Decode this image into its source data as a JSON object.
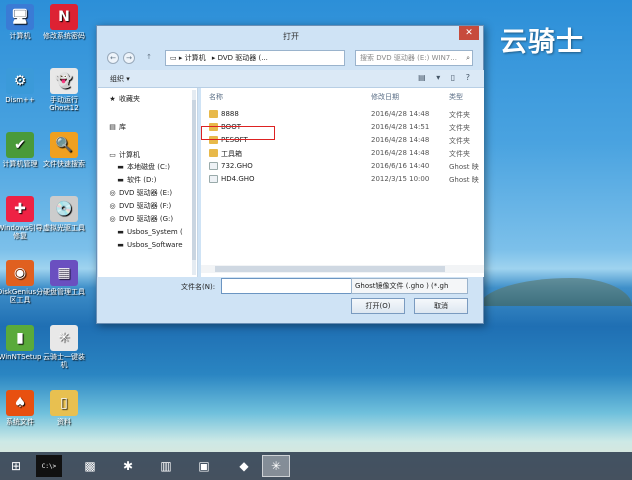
{
  "brand": "云骑士",
  "desktop_icons": [
    {
      "label": "计算机",
      "glyph": "🖥"
    },
    {
      "label": "修改系统密码",
      "glyph": "N"
    },
    {
      "label": "Dism++",
      "glyph": "⚙"
    },
    {
      "label": "手动运行 Ghost12",
      "glyph": "👻"
    },
    {
      "label": "计算机管理",
      "glyph": "✔"
    },
    {
      "label": "文件快速搜索",
      "glyph": "🔍"
    },
    {
      "label": "Windows引导修复",
      "glyph": "✚"
    },
    {
      "label": "虚拟光驱工具",
      "glyph": "💿"
    },
    {
      "label": "DiskGenius分区工具",
      "glyph": "◉"
    },
    {
      "label": "硬盘管理工具",
      "glyph": "▦"
    },
    {
      "label": "WinNTSetup",
      "glyph": "▮"
    },
    {
      "label": "云骑士一键装机",
      "glyph": "✳"
    },
    {
      "label": "系统文件",
      "glyph": "♠"
    },
    {
      "label": "资料",
      "glyph": "▯"
    }
  ],
  "dialog": {
    "title": "打开",
    "close": "✕",
    "back": "←",
    "forward": "→",
    "up": "↑",
    "breadcrumbs": [
      "计算机",
      "DVD 驱动器 (..."
    ],
    "search_placeholder": "搜索 DVD 驱动器 (E:) WIN7...",
    "organize": "组织 ▾",
    "nav_items": [
      {
        "label": "收藏夹",
        "glyph": "★"
      },
      {
        "label": "库",
        "glyph": "▤"
      },
      {
        "label": "计算机",
        "glyph": "▭"
      },
      {
        "label": "本地磁盘 (C:)",
        "glyph": "▬"
      },
      {
        "label": "软件 (D:)",
        "glyph": "▬"
      },
      {
        "label": "DVD 驱动器 (E:)",
        "glyph": "◎"
      },
      {
        "label": "DVD 驱动器 (F:)",
        "glyph": "◎"
      },
      {
        "label": "DVD 驱动器 (G:)",
        "glyph": "◎"
      },
      {
        "label": "Usbos_System (",
        "glyph": "▬"
      },
      {
        "label": "Usbos_Software",
        "glyph": "▬"
      }
    ],
    "columns": {
      "name": "名称",
      "date": "修改日期",
      "type": "类型"
    },
    "files": [
      {
        "name": "8888",
        "date": "2016/4/28 14:48",
        "type": "文件夹",
        "kind": "folder"
      },
      {
        "name": "BOOT",
        "date": "2016/4/28 14:51",
        "type": "文件夹",
        "kind": "folder"
      },
      {
        "name": "PESOFT",
        "date": "2016/4/28 14:48",
        "type": "文件夹",
        "kind": "folder"
      },
      {
        "name": "工具箱",
        "date": "2016/4/28 14:48",
        "type": "文件夹",
        "kind": "folder"
      },
      {
        "name": "732.GHO",
        "date": "2016/6/16 14:40",
        "type": "Ghost 映",
        "kind": "gho"
      },
      {
        "name": "HD4.GHO",
        "date": "2012/3/15 10:00",
        "type": "Ghost 映",
        "kind": "gho"
      }
    ],
    "filename_label": "文件名(N):",
    "filename_value": "",
    "filter_value": "Ghost镜像文件 (.gho ) (*.gh",
    "open_button": "打开(O)",
    "cancel_button": "取消"
  },
  "taskbar": {
    "start": "⊞",
    "items": [
      "C:\\>",
      "▩",
      "✱",
      "▥",
      "▣",
      "◆",
      "✳"
    ]
  }
}
